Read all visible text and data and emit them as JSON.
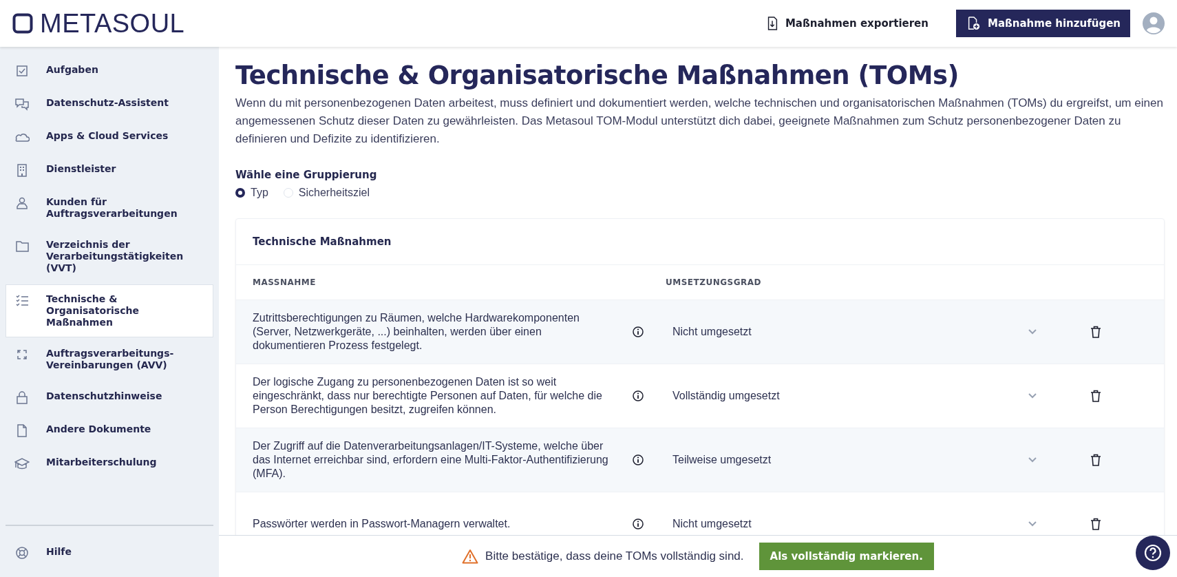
{
  "header": {
    "logo": "METASOUL",
    "export_link": "Maßnahmen exportieren",
    "add_button": "Maßnahme hinzufügen"
  },
  "sidebar": {
    "items": [
      {
        "label": "Aufgaben",
        "kind": "tasks",
        "selected": false
      },
      {
        "label": "Datenschutz-Assistent",
        "kind": "chat",
        "selected": false
      },
      {
        "label": "Apps & Cloud Services",
        "kind": "cloud",
        "selected": false
      },
      {
        "label": "Dienstleister",
        "kind": "building",
        "selected": false
      },
      {
        "label": "Kunden für Auftragsverarbeitungen",
        "kind": "person",
        "selected": false
      },
      {
        "label": "Verzeichnis der Verarbeitungstätigkeiten (VVT)",
        "kind": "folder",
        "selected": false
      },
      {
        "label": "Technische & Organisatorische Maßnahmen",
        "kind": "list",
        "selected": true
      },
      {
        "label": "Auftragsverarbeitungs-Vereinbarungen (AVV)",
        "kind": "sync",
        "selected": false
      },
      {
        "label": "Datenschutzhinweise",
        "kind": "lock",
        "selected": false
      },
      {
        "label": "Andere Dokumente",
        "kind": "document",
        "selected": false
      },
      {
        "label": "Mitarbeiterschulung",
        "kind": "graduation",
        "selected": false
      }
    ],
    "footer_item": {
      "label": "Hilfe",
      "kind": "lifebuoy"
    }
  },
  "page": {
    "title": "Technische & Organisatorische Maßnahmen (TOMs)",
    "description": "Wenn du mit personenbezogenen Daten arbeitest, muss definiert und dokumentiert werden, welche technischen und organisatorischen Maßnahmen (TOMs) du ergreifst, um einen angemessenen Schutz dieser Daten zu gewährleisten. Das Metasoul TOM-Modul unterstützt dich dabei, geeignete Maßnahmen zum Schutz personenbezogener Daten zu definieren und Defizite zu identifizieren.",
    "grouping": {
      "label": "Wähle eine Gruppierung",
      "options": [
        {
          "label": "Typ",
          "selected": true
        },
        {
          "label": "Sicherheitsziel",
          "selected": false
        }
      ]
    }
  },
  "table": {
    "title": "Technische Maßnahmen",
    "columns": [
      "MASSNAHME",
      "UMSETZUNGSGRAD"
    ],
    "rows": [
      {
        "measure": "Zutrittsberechtigungen zu Räumen, welche Hardwarekomponenten (Server, Netzwerkgeräte, ...) beinhalten, werden über einen dokumentieren Prozess festgelegt.",
        "status": "Nicht umgesetzt"
      },
      {
        "measure": "Der logische Zugang zu personenbezogenen Daten ist so weit eingeschränkt, dass nur berechtigte Personen auf Daten, für welche die Person Berechtigungen besitzt, zugreifen können.",
        "status": "Vollständig umgesetzt"
      },
      {
        "measure": "Der Zugriff auf die Datenverarbeitungsanlagen/IT-Systeme, welche über das Internet erreichbar sind, erfordern eine Multi-Faktor-Authentifizierung (MFA).",
        "status": "Teilweise umgesetzt"
      },
      {
        "measure": "Passwörter werden in Passwort-Managern verwaltet.",
        "status": "Nicht umgesetzt"
      }
    ]
  },
  "footer_bar": {
    "message": "Bitte bestätige, dass deine TOMs vollständig sind.",
    "button": "Als vollständig markieren."
  }
}
